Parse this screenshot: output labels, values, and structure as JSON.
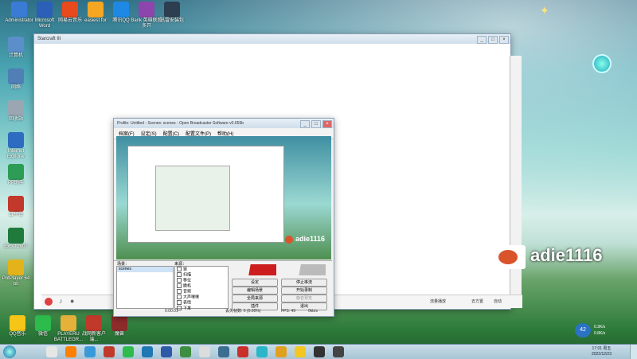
{
  "desktop": {
    "top_icons": [
      "Administrator",
      "Microsoft Word",
      "网易云音乐",
      "easiest for",
      "腾讯QQ",
      "Bank 英雄联盟多开",
      "迅雷安装包"
    ],
    "left_icons": [
      "计算机",
      "网络",
      "回收站",
      "Internet Explorer",
      "PP助手",
      "11平台",
      "Excel 2007",
      "PotPlayer 64 bit"
    ],
    "bottom_icons": [
      "QQ音乐",
      "微信",
      "PLAYERU BATTLEGR...",
      "战网新客户端...",
      "魔兽"
    ]
  },
  "main_window": {
    "title": "Starcraft III"
  },
  "obs": {
    "title": "Profile: Untitled - Scenes: scenes - Open Broadcaster Software v0.659b",
    "menu": [
      "档案(F)",
      "设定(S)",
      "配置(C)",
      "配置文件(P)",
      "帮助(H)"
    ],
    "scenes_label": "场景：",
    "sources_label": "来源：",
    "scene_item": "scenes",
    "sources": [
      "窗",
      "扫描",
      "移位",
      "撤机",
      "音频",
      "大声嚷嚷",
      "表情",
      "下发"
    ],
    "buttons": {
      "settings": "设定",
      "stop_preview": "停止串流",
      "edit_scene": "编辑场景",
      "start_record": "开始录制",
      "global_sources": "全局来源",
      "mute_preview": "静音预览",
      "plugins": "插件",
      "exit": "退出"
    },
    "status": {
      "time": "0:00:01",
      "dropped": "丢失帧数: 0 (0.00%)",
      "fps": "FPS: 49",
      "kbps": "0kb/s"
    },
    "streamer_name": "adie1116"
  },
  "overlay": {
    "streamer_name": "adie1116"
  },
  "media_bar": {
    "label1": "流量播放",
    "label2": "去方置",
    "label3": "自动"
  },
  "tray": {
    "battery": "42",
    "up": "0.3K/s",
    "down": "0.8K/s",
    "time": "17:01 周五",
    "date": "2022/12/23"
  },
  "colors": {
    "crab": "#d9542b",
    "level_red": "#cc1e1e",
    "taskbar": "#b6cfdd"
  }
}
